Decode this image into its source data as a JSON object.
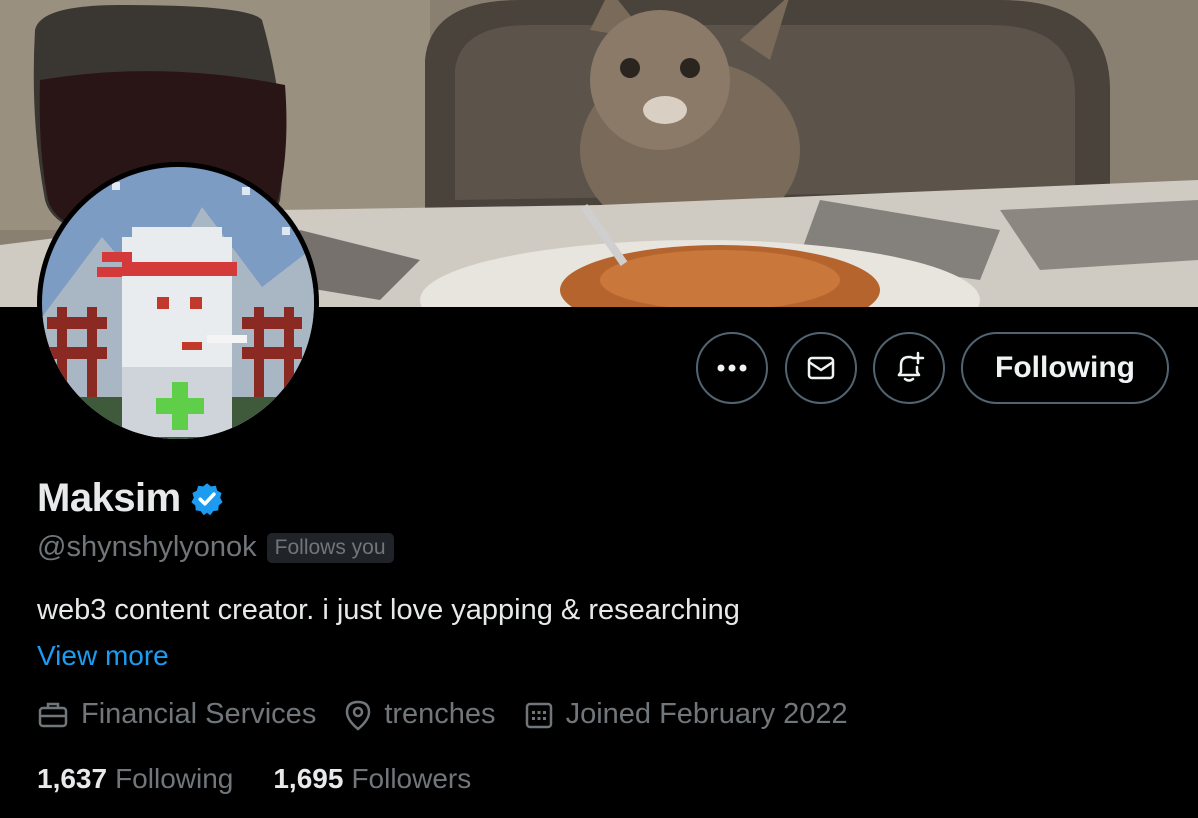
{
  "banner": {
    "icon": "banner-photo-cat-at-dinner-table"
  },
  "avatar": {
    "icon": "pixel-art-ninja-avatar"
  },
  "actions": {
    "more_icon": "more-icon",
    "message_icon": "envelope-icon",
    "notify_icon": "bell-plus-icon",
    "follow_label": "Following"
  },
  "profile": {
    "name": "Maksim",
    "verified_icon": "verified-badge-icon",
    "handle": "@shynshylyonok",
    "follows_you": "Follows you",
    "bio": "web3 content creator. i just love yapping & researching",
    "view_more": "View more"
  },
  "meta": {
    "category": "Financial Services",
    "location": "trenches",
    "joined": "Joined February 2022"
  },
  "stats": {
    "following_count": "1,637",
    "following_label": "Following",
    "followers_count": "1,695",
    "followers_label": "Followers"
  },
  "colors": {
    "background": "#000000",
    "text_primary": "#e7e9ea",
    "text_secondary": "#71767b",
    "link": "#1d9bf0",
    "border": "#536471"
  }
}
